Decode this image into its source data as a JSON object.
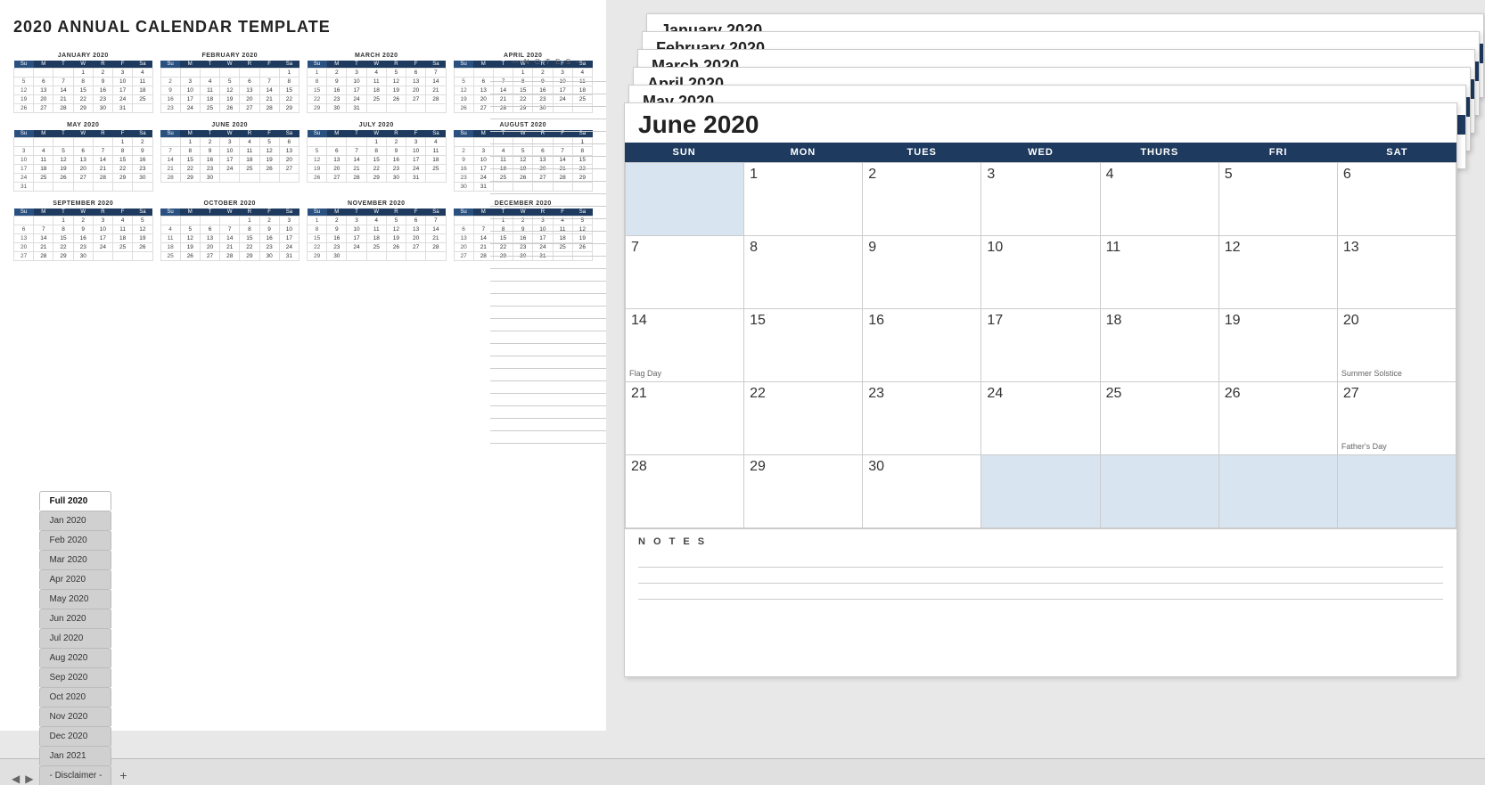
{
  "page": {
    "title": "2020 ANNUAL CALENDAR TEMPLATE"
  },
  "miniCalendars": [
    {
      "id": "jan2020",
      "title": "JANUARY 2020",
      "headers": [
        "Su",
        "M",
        "T",
        "W",
        "R",
        "F",
        "Sa"
      ],
      "rows": [
        [
          "",
          "",
          "",
          "1",
          "2",
          "3",
          "4"
        ],
        [
          "5",
          "6",
          "7",
          "8",
          "9",
          "10",
          "11"
        ],
        [
          "12",
          "13",
          "14",
          "15",
          "16",
          "17",
          "18"
        ],
        [
          "19",
          "20",
          "21",
          "22",
          "23",
          "24",
          "25"
        ],
        [
          "26",
          "27",
          "28",
          "29",
          "30",
          "31",
          ""
        ]
      ]
    },
    {
      "id": "feb2020",
      "title": "FEBRUARY 2020",
      "headers": [
        "Su",
        "M",
        "T",
        "W",
        "R",
        "F",
        "Sa"
      ],
      "rows": [
        [
          "",
          "",
          "",
          "",
          "",
          "",
          "1"
        ],
        [
          "2",
          "3",
          "4",
          "5",
          "6",
          "7",
          "8"
        ],
        [
          "9",
          "10",
          "11",
          "12",
          "13",
          "14",
          "15"
        ],
        [
          "16",
          "17",
          "18",
          "19",
          "20",
          "21",
          "22"
        ],
        [
          "23",
          "24",
          "25",
          "26",
          "27",
          "28",
          "29"
        ]
      ]
    },
    {
      "id": "mar2020",
      "title": "MARCH 2020",
      "headers": [
        "Su",
        "M",
        "T",
        "W",
        "R",
        "F",
        "Sa"
      ],
      "rows": [
        [
          "1",
          "2",
          "3",
          "4",
          "5",
          "6",
          "7"
        ],
        [
          "8",
          "9",
          "10",
          "11",
          "12",
          "13",
          "14"
        ],
        [
          "15",
          "16",
          "17",
          "18",
          "19",
          "20",
          "21"
        ],
        [
          "22",
          "23",
          "24",
          "25",
          "26",
          "27",
          "28"
        ],
        [
          "29",
          "30",
          "31",
          "",
          "",
          "",
          ""
        ]
      ]
    },
    {
      "id": "apr2020",
      "title": "APRIL 2020",
      "headers": [
        "Su",
        "M",
        "T",
        "W",
        "R",
        "F",
        "Sa"
      ],
      "rows": [
        [
          "",
          "",
          "",
          "1",
          "2",
          "3",
          "4"
        ],
        [
          "5",
          "6",
          "7",
          "8",
          "9",
          "10",
          "11"
        ],
        [
          "12",
          "13",
          "14",
          "15",
          "16",
          "17",
          "18"
        ],
        [
          "19",
          "20",
          "21",
          "22",
          "23",
          "24",
          "25"
        ],
        [
          "26",
          "27",
          "28",
          "29",
          "30",
          "",
          ""
        ]
      ]
    },
    {
      "id": "may2020",
      "title": "MAY 2020",
      "headers": [
        "Su",
        "M",
        "T",
        "W",
        "R",
        "F",
        "Sa"
      ],
      "rows": [
        [
          "",
          "",
          "",
          "",
          "",
          "1",
          "2"
        ],
        [
          "3",
          "4",
          "5",
          "6",
          "7",
          "8",
          "9"
        ],
        [
          "10",
          "11",
          "12",
          "13",
          "14",
          "15",
          "16"
        ],
        [
          "17",
          "18",
          "19",
          "20",
          "21",
          "22",
          "23"
        ],
        [
          "24",
          "25",
          "26",
          "27",
          "28",
          "29",
          "30"
        ],
        [
          "31",
          "",
          "",
          "",
          "",
          "",
          ""
        ]
      ]
    },
    {
      "id": "jun2020",
      "title": "JUNE 2020",
      "headers": [
        "Su",
        "M",
        "T",
        "W",
        "R",
        "F",
        "Sa"
      ],
      "rows": [
        [
          "",
          "1",
          "2",
          "3",
          "4",
          "5",
          "6"
        ],
        [
          "7",
          "8",
          "9",
          "10",
          "11",
          "12",
          "13"
        ],
        [
          "14",
          "15",
          "16",
          "17",
          "18",
          "19",
          "20"
        ],
        [
          "21",
          "22",
          "23",
          "24",
          "25",
          "26",
          "27"
        ],
        [
          "28",
          "29",
          "30",
          "",
          "",
          "",
          ""
        ]
      ]
    },
    {
      "id": "jul2020",
      "title": "JULY 2020",
      "headers": [
        "Su",
        "M",
        "T",
        "W",
        "R",
        "F",
        "Sa"
      ],
      "rows": [
        [
          "",
          "",
          "",
          "1",
          "2",
          "3",
          "4"
        ],
        [
          "5",
          "6",
          "7",
          "8",
          "9",
          "10",
          "11"
        ],
        [
          "12",
          "13",
          "14",
          "15",
          "16",
          "17",
          "18"
        ],
        [
          "19",
          "20",
          "21",
          "22",
          "23",
          "24",
          "25"
        ],
        [
          "26",
          "27",
          "28",
          "29",
          "30",
          "31",
          ""
        ]
      ]
    },
    {
      "id": "aug2020",
      "title": "AUGUST 2020",
      "headers": [
        "Su",
        "M",
        "T",
        "W",
        "R",
        "F",
        "Sa"
      ],
      "rows": [
        [
          "",
          "",
          "",
          "",
          "",
          "",
          "1"
        ],
        [
          "2",
          "3",
          "4",
          "5",
          "6",
          "7",
          "8"
        ],
        [
          "9",
          "10",
          "11",
          "12",
          "13",
          "14",
          "15"
        ],
        [
          "16",
          "17",
          "18",
          "19",
          "20",
          "21",
          "22"
        ],
        [
          "23",
          "24",
          "25",
          "26",
          "27",
          "28",
          "29"
        ],
        [
          "30",
          "31",
          "",
          "",
          "",
          "",
          ""
        ]
      ]
    },
    {
      "id": "sep2020",
      "title": "SEPTEMBER 2020",
      "headers": [
        "Su",
        "M",
        "T",
        "W",
        "R",
        "F",
        "Sa"
      ],
      "rows": [
        [
          "",
          "",
          "1",
          "2",
          "3",
          "4",
          "5"
        ],
        [
          "6",
          "7",
          "8",
          "9",
          "10",
          "11",
          "12"
        ],
        [
          "13",
          "14",
          "15",
          "16",
          "17",
          "18",
          "19"
        ],
        [
          "20",
          "21",
          "22",
          "23",
          "24",
          "25",
          "26"
        ],
        [
          "27",
          "28",
          "29",
          "30",
          "",
          "",
          ""
        ]
      ]
    },
    {
      "id": "oct2020",
      "title": "OCTOBER 2020",
      "headers": [
        "Su",
        "M",
        "T",
        "W",
        "R",
        "F",
        "Sa"
      ],
      "rows": [
        [
          "",
          "",
          "",
          "",
          "1",
          "2",
          "3"
        ],
        [
          "4",
          "5",
          "6",
          "7",
          "8",
          "9",
          "10"
        ],
        [
          "11",
          "12",
          "13",
          "14",
          "15",
          "16",
          "17"
        ],
        [
          "18",
          "19",
          "20",
          "21",
          "22",
          "23",
          "24"
        ],
        [
          "25",
          "26",
          "27",
          "28",
          "29",
          "30",
          "31"
        ]
      ]
    },
    {
      "id": "nov2020",
      "title": "NOVEMBER 2020",
      "headers": [
        "Su",
        "M",
        "T",
        "W",
        "R",
        "F",
        "Sa"
      ],
      "rows": [
        [
          "1",
          "2",
          "3",
          "4",
          "5",
          "6",
          "7"
        ],
        [
          "8",
          "9",
          "10",
          "11",
          "12",
          "13",
          "14"
        ],
        [
          "15",
          "16",
          "17",
          "18",
          "19",
          "20",
          "21"
        ],
        [
          "22",
          "23",
          "24",
          "25",
          "26",
          "27",
          "28"
        ],
        [
          "29",
          "30",
          "",
          "",
          "",
          "",
          ""
        ]
      ]
    },
    {
      "id": "dec2020",
      "title": "DECEMBER 2020",
      "headers": [
        "Su",
        "M",
        "T",
        "W",
        "R",
        "F",
        "Sa"
      ],
      "rows": [
        [
          "",
          "",
          "1",
          "2",
          "3",
          "4",
          "5"
        ],
        [
          "6",
          "7",
          "8",
          "9",
          "10",
          "11",
          "12"
        ],
        [
          "13",
          "14",
          "15",
          "16",
          "17",
          "18",
          "19"
        ],
        [
          "20",
          "21",
          "22",
          "23",
          "24",
          "25",
          "26"
        ],
        [
          "27",
          "28",
          "29",
          "30",
          "31",
          "",
          ""
        ]
      ]
    }
  ],
  "notes": {
    "title": "— N O T E S —",
    "lineCount": 30
  },
  "monthlyView": {
    "months": [
      "January 2020",
      "February 2020",
      "March 2020",
      "April 2020",
      "May 2020",
      "June 2020"
    ],
    "headers": [
      "SUN",
      "MON",
      "TUES",
      "WED",
      "THURS",
      "FRI",
      "SAT"
    ],
    "june": {
      "title": "June 2020",
      "rows": [
        [
          {
            "empty": true
          },
          {
            "num": "1"
          },
          {
            "num": "2"
          },
          {
            "num": "3"
          },
          {
            "num": "4"
          },
          {
            "num": "5"
          },
          {
            "num": "6"
          }
        ],
        [
          {
            "num": "7"
          },
          {
            "num": "8"
          },
          {
            "num": "9"
          },
          {
            "num": "10"
          },
          {
            "num": "11"
          },
          {
            "num": "12"
          },
          {
            "num": "13"
          }
        ],
        [
          {
            "num": "14",
            "holiday": "Flag Day"
          },
          {
            "num": "15"
          },
          {
            "num": "16"
          },
          {
            "num": "17"
          },
          {
            "num": "18"
          },
          {
            "num": "19"
          },
          {
            "num": "20",
            "holiday": "Summer Solstice"
          }
        ],
        [
          {
            "num": "21"
          },
          {
            "num": "22"
          },
          {
            "num": "23"
          },
          {
            "num": "24"
          },
          {
            "num": "25"
          },
          {
            "num": "26"
          },
          {
            "num": "27",
            "holiday": "Father's Day"
          }
        ],
        [
          {
            "num": "28"
          },
          {
            "num": "29"
          },
          {
            "num": "30"
          },
          {
            "empty": true
          },
          {
            "empty": true
          },
          {
            "empty": true
          },
          {
            "empty": true
          }
        ]
      ]
    }
  },
  "tabs": [
    {
      "label": "Full 2020",
      "active": true
    },
    {
      "label": "Jan 2020",
      "active": false
    },
    {
      "label": "Feb 2020",
      "active": false
    },
    {
      "label": "Mar 2020",
      "active": false
    },
    {
      "label": "Apr 2020",
      "active": false
    },
    {
      "label": "May 2020",
      "active": false
    },
    {
      "label": "Jun 2020",
      "active": false
    },
    {
      "label": "Jul 2020",
      "active": false
    },
    {
      "label": "Aug 2020",
      "active": false
    },
    {
      "label": "Sep 2020",
      "active": false
    },
    {
      "label": "Oct 2020",
      "active": false
    },
    {
      "label": "Nov 2020",
      "active": false
    },
    {
      "label": "Dec 2020",
      "active": false
    },
    {
      "label": "Jan 2021",
      "active": false
    },
    {
      "label": "- Disclaimer -",
      "active": false
    }
  ],
  "colors": {
    "headerBg": "#1e3a5f",
    "headerText": "#ffffff",
    "emptyCellBg": "#d0dce8",
    "notesLineBg": "#f9f9f9"
  }
}
